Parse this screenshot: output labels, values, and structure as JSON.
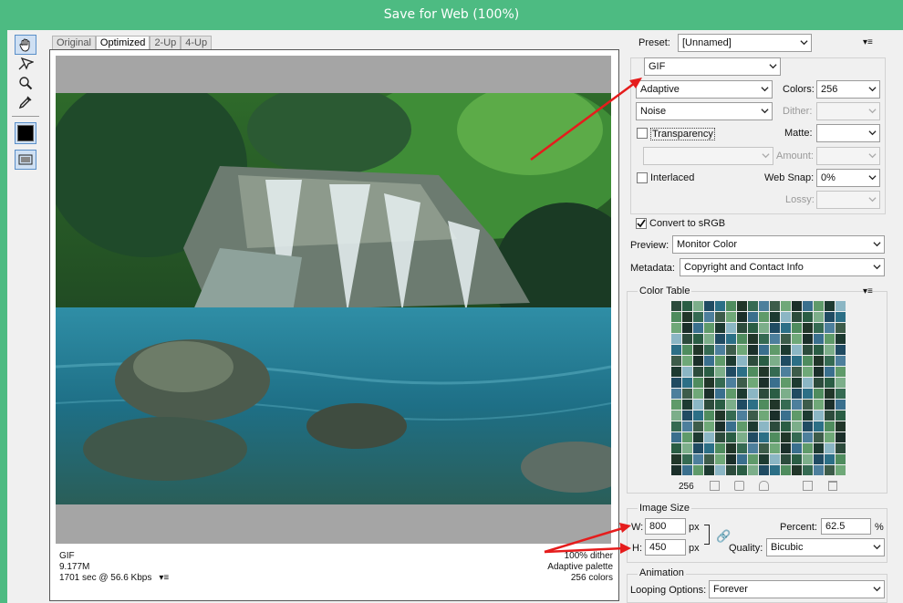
{
  "window": {
    "title": "Save for Web (100%)"
  },
  "tools": [
    {
      "name": "hand-tool-icon",
      "selected": true
    },
    {
      "name": "slice-select-tool-icon",
      "selected": false
    },
    {
      "name": "zoom-tool-icon",
      "selected": false
    },
    {
      "name": "eyedropper-tool-icon",
      "selected": false
    },
    {
      "name": "eyedropper-color-swatch",
      "selected": false
    },
    {
      "name": "toggle-slices-visibility-icon",
      "selected": true
    }
  ],
  "tabs": [
    "Original",
    "Optimized",
    "2-Up",
    "4-Up"
  ],
  "active_tab": "Optimized",
  "preview_info": {
    "format": "GIF",
    "size": "9.177M",
    "time": "1701 sec @ 56.6 Kbps",
    "dither": "100% dither",
    "palette": "Adaptive palette",
    "colors": "256 colors"
  },
  "settings": {
    "preset_label": "Preset:",
    "preset_value": "[Unnamed]",
    "format_value": "GIF",
    "reduction_value": "Adaptive",
    "colors_label": "Colors:",
    "colors_value": "256",
    "dither_algo_value": "Noise",
    "dither_label": "Dither:",
    "transparency_label": "Transparency",
    "matte_label": "Matte:",
    "amount_label": "Amount:",
    "interlaced_label": "Interlaced",
    "websnap_label": "Web Snap:",
    "websnap_value": "0%",
    "lossy_label": "Lossy:",
    "convert_label": "Convert to sRGB",
    "preview_label": "Preview:",
    "preview_value": "Monitor Color",
    "metadata_label": "Metadata:",
    "metadata_value": "Copyright and Contact Info"
  },
  "color_table": {
    "title": "Color Table",
    "count": "256",
    "colors": [
      "#2c4b3c",
      "#356a52",
      "#1d3a31",
      "#4f8c5e",
      "#3a6f8d",
      "#204b62",
      "#6fa878",
      "#2a5d44",
      "#4d7f9c",
      "#8bb6c4",
      "#213629",
      "#5f9a6a",
      "#2c6f86",
      "#1b2f2a",
      "#7cae8a",
      "#3d5c4a"
    ]
  },
  "image_size": {
    "title": "Image Size",
    "w_label": "W:",
    "w_value": "800",
    "h_label": "H:",
    "h_value": "450",
    "unit": "px",
    "percent_label": "Percent:",
    "percent_value": "62.5",
    "percent_unit": "%",
    "quality_label": "Quality:",
    "quality_value": "Bicubic"
  },
  "animation": {
    "title": "Animation",
    "looping_label": "Looping Options:",
    "looping_value": "Forever"
  },
  "accents": {
    "title_bar": "#4dbb82",
    "annotation_arrow": "#e51c1c"
  }
}
